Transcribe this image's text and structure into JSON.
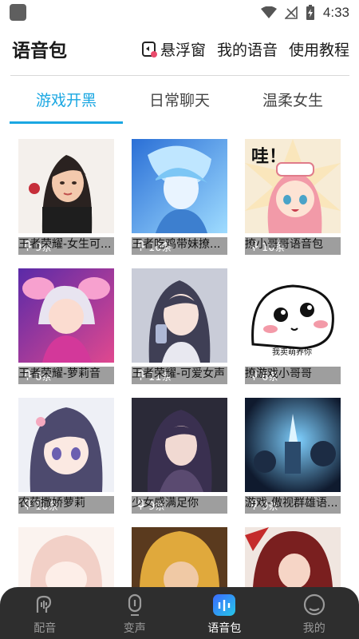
{
  "status_bar": {
    "time": "4:33"
  },
  "header": {
    "title": "语音包",
    "float_window_label": "悬浮窗",
    "my_voice_label": "我的语音",
    "tutorial_label": "使用教程"
  },
  "tabs": [
    {
      "label": "游戏开黑",
      "active": true
    },
    {
      "label": "日常聊天",
      "active": false
    },
    {
      "label": "温柔女生",
      "active": false
    }
  ],
  "cards": [
    {
      "title": "王者荣耀-女生可...",
      "count": "9条",
      "icon": "girl-portrait-thumbnail"
    },
    {
      "title": "王者吃鸡带妹撩...",
      "count": "10条",
      "icon": "blue-anime-boy-thumbnail"
    },
    {
      "title": "撩小哥哥语音包",
      "count": "10条",
      "icon": "pink-hair-girl-thumbnail",
      "thumb_text": "哇！"
    },
    {
      "title": "王者荣耀-萝莉音",
      "count": "6条",
      "icon": "game-character-thumbnail"
    },
    {
      "title": "王者荣耀-可爱女声",
      "count": "11条",
      "icon": "anime-girl-phone-thumbnail"
    },
    {
      "title": "撩游戏小哥哥",
      "count": "6条",
      "icon": "blush-face-sticker-thumbnail",
      "thumb_text": "我卖萌养你"
    },
    {
      "title": "农药撒娇萝莉",
      "count": "10条",
      "icon": "purple-hair-girl-thumbnail"
    },
    {
      "title": "少女感满足你",
      "count": "9条",
      "icon": "dark-hair-girl-thumbnail"
    },
    {
      "title": "游戏-傲视群雄语...",
      "count": "9条",
      "icon": "game-battle-thumbnail"
    },
    {
      "title": "",
      "count": "",
      "icon": "sketch-girl-thumbnail"
    },
    {
      "title": "",
      "count": "",
      "icon": "blonde-character-thumbnail"
    },
    {
      "title": "",
      "count": "",
      "icon": "red-hair-hero-thumbnail"
    }
  ],
  "bottom_nav": [
    {
      "label": "配音",
      "icon": "dubbing-icon",
      "active": false
    },
    {
      "label": "变声",
      "icon": "microphone-icon",
      "active": false
    },
    {
      "label": "语音包",
      "icon": "voice-pack-icon",
      "active": true
    },
    {
      "label": "我的",
      "icon": "profile-icon",
      "active": false
    }
  ],
  "colors": {
    "accent": "#1aa7e2",
    "nav_bg": "#2e2e2e"
  }
}
